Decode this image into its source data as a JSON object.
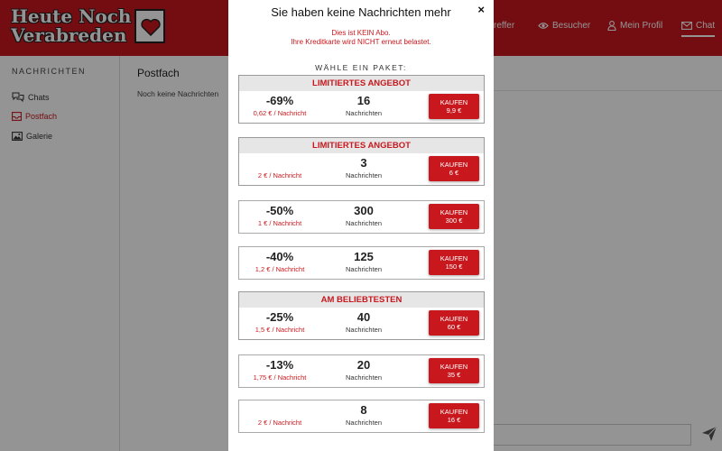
{
  "app": {
    "logo_line1": "Heute Noch",
    "logo_line2": "Verabreden"
  },
  "topnav": [
    {
      "label": "reffer"
    },
    {
      "label": "Besucher"
    },
    {
      "label": "Mein Profil"
    },
    {
      "label": "Chat"
    }
  ],
  "sidebar": {
    "title": "NACHRICHTEN",
    "items": [
      {
        "label": "Chats"
      },
      {
        "label": "Postfach"
      },
      {
        "label": "Galerie"
      }
    ]
  },
  "inbox": {
    "title": "Postfach",
    "empty_text": "Noch keine Nachrichten"
  },
  "modal": {
    "title": "Sie haben keine Nachrichten mehr",
    "close": "×",
    "notice_line1": "Dies ist KEIN Abo.",
    "notice_line2": "Ihre Kreditkarte wird NICHT erneut belastet.",
    "choose_label": "WÄHLE EIN PAKET:",
    "packages": [
      {
        "header": "LIMITIERTES ANGEBOT",
        "discount": "-69%",
        "unit_price": "0,62 € / Nachricht",
        "count": "16",
        "count_label": "Nachrichten",
        "buy_label": "KAUFEN",
        "price": "9,9 €"
      },
      {
        "header": "LIMITIERTES ANGEBOT",
        "discount": "",
        "unit_price": "2 € / Nachricht",
        "count": "3",
        "count_label": "Nachrichten",
        "buy_label": "KAUFEN",
        "price": "6 €"
      },
      {
        "header": "",
        "discount": "-50%",
        "unit_price": "1 € / Nachricht",
        "count": "300",
        "count_label": "Nachrichten",
        "buy_label": "KAUFEN",
        "price": "300 €"
      },
      {
        "header": "",
        "discount": "-40%",
        "unit_price": "1,2 € / Nachricht",
        "count": "125",
        "count_label": "Nachrichten",
        "buy_label": "KAUFEN",
        "price": "150 €"
      },
      {
        "header": "AM BELIEBTESTEN",
        "discount": "-25%",
        "unit_price": "1,5 € / Nachricht",
        "count": "40",
        "count_label": "Nachrichten",
        "buy_label": "KAUFEN",
        "price": "60 €"
      },
      {
        "header": "",
        "discount": "-13%",
        "unit_price": "1,75 € / Nachricht",
        "count": "20",
        "count_label": "Nachrichten",
        "buy_label": "KAUFEN",
        "price": "35 €"
      },
      {
        "header": "",
        "discount": "",
        "unit_price": "2 € / Nachricht",
        "count": "8",
        "count_label": "Nachrichten",
        "buy_label": "KAUFEN",
        "price": "16 €"
      }
    ]
  },
  "colors": {
    "brand_red": "#c8181e",
    "header_grey": "#e6e6e6"
  },
  "icons": [
    "heart-logo-icon",
    "eye-icon",
    "user-icon",
    "mail-icon",
    "chats-icon",
    "inbox-icon",
    "gallery-icon",
    "send-icon"
  ]
}
